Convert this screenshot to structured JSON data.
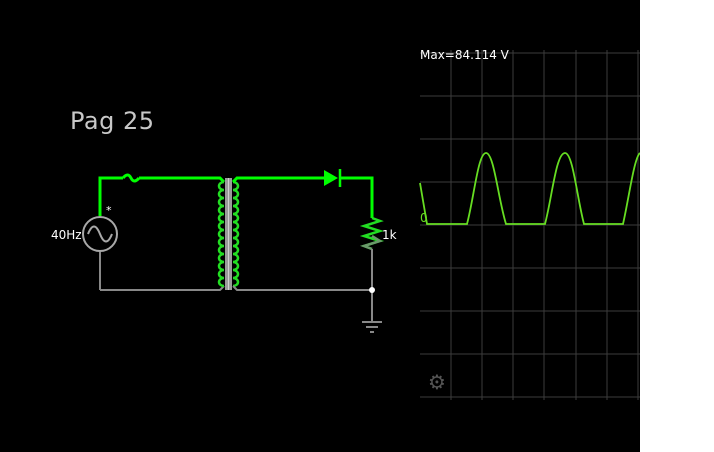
{
  "page_title": "Pag 25",
  "source": {
    "frequency_label": "40Hz",
    "marker": "*"
  },
  "resistor": {
    "label": "1k"
  },
  "scope": {
    "max_label": "Max=84.114 V",
    "zero_label": "0",
    "settings_icon": "gear-icon"
  },
  "colors": {
    "background": "#000000",
    "active_wire": "#00ff00",
    "inactive_wire": "#808080",
    "grid": "#3a3a3a",
    "trace": "#66dd22",
    "text": "#ffffff",
    "title": "#c8c8c8"
  }
}
